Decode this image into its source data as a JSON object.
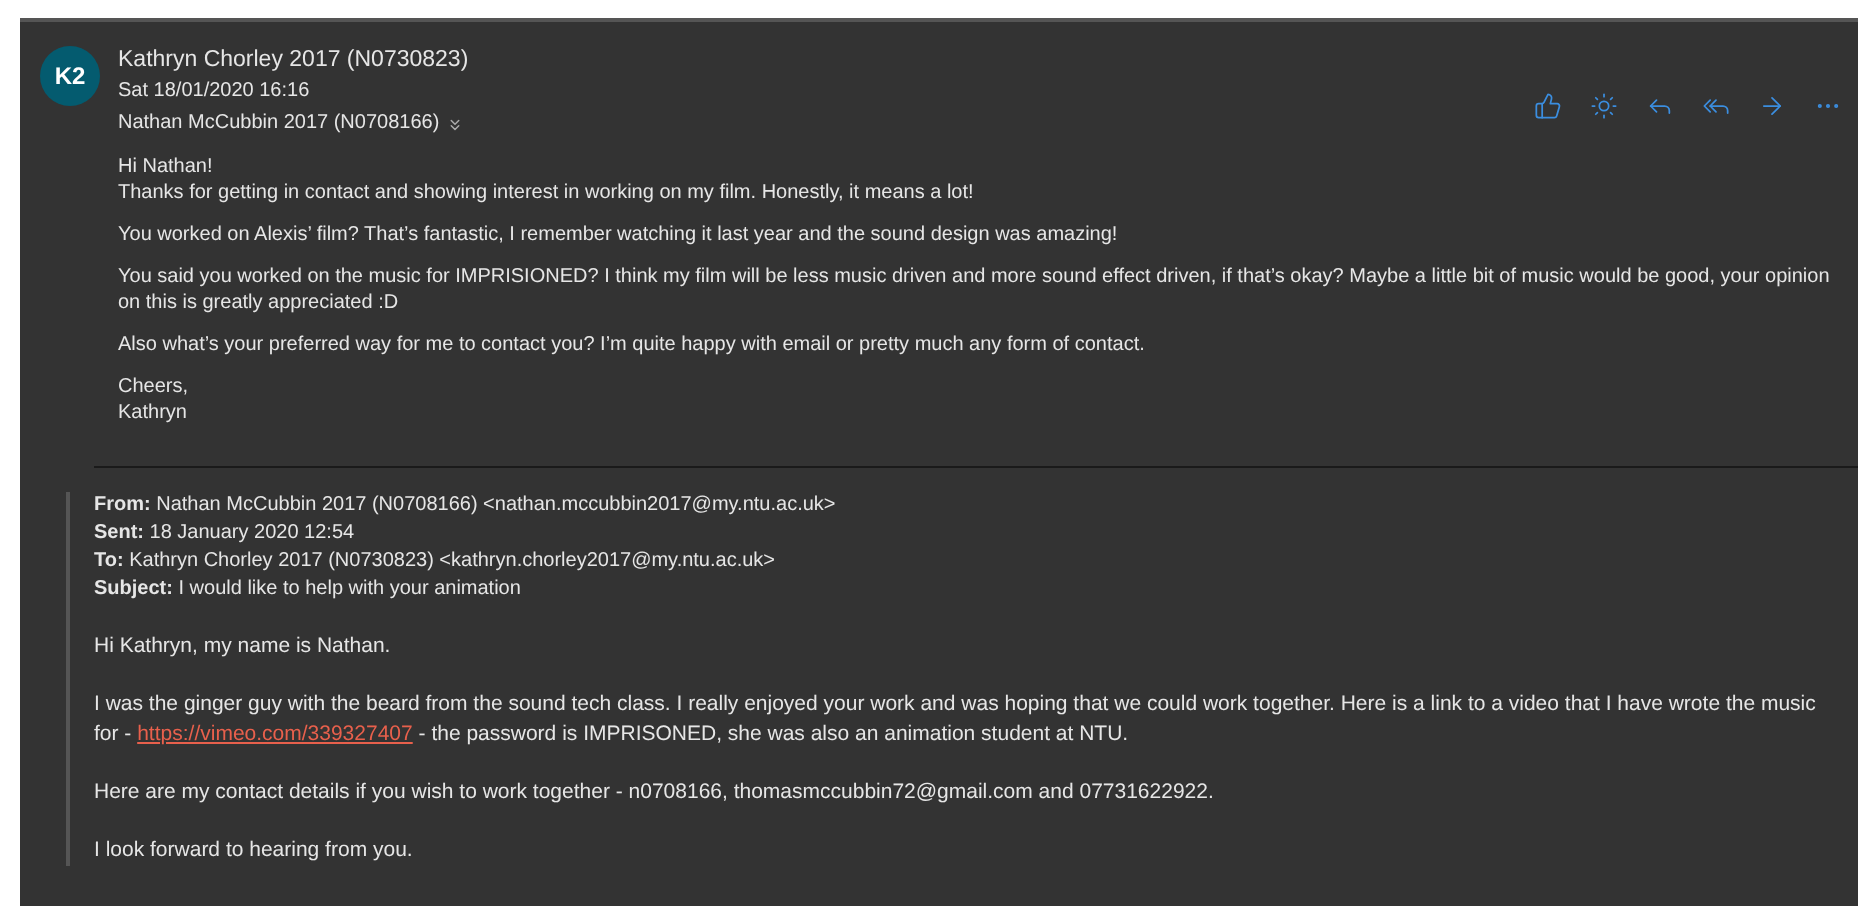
{
  "message": {
    "avatar": "K2",
    "sender": "Kathryn Chorley 2017 (N0730823)",
    "date": "Sat 18/01/2020 16:16",
    "recipient": "Nathan McCubbin 2017 (N0708166)",
    "body": [
      [
        "Hi Nathan!",
        "Thanks for getting in contact and showing interest in working on my film. Honestly, it means a lot!"
      ],
      [
        "You worked on Alexis’ film? That’s fantastic, I remember watching it last year and the sound design was amazing!"
      ],
      [
        "You said you worked on the music for IMPRISIONED? I think my film will be less music driven and more sound effect driven, if that’s okay? Maybe a little bit of music would be good, your opinion on this is greatly appreciated :D"
      ],
      [
        "Also what’s your preferred way for me to contact you? I’m quite happy with email or pretty much any form of contact."
      ],
      [
        "Cheers,",
        "Kathryn"
      ]
    ]
  },
  "quoted": {
    "headers": [
      "**From:** Nathan McCubbin 2017 (N0708166) <nathan.mccubbin2017@my.ntu.ac.uk>",
      "**Sent:** 18 January 2020 12:54",
      "**To:** Kathryn Chorley 2017 (N0730823) <kathryn.chorley2017@my.ntu.ac.uk>",
      "**Subject:** I would like to help with your animation"
    ],
    "paragraphs": [
      {
        "text": "Hi Kathryn, my name is Nathan."
      },
      {
        "text": "I was the ginger guy with the beard from the sound tech class. I really enjoyed your work and was hoping that we could work together. Here is a link to a video that I have wrote the music for -",
        "link": "https://vimeo.com/339327407",
        "after": "- the password is IMPRISONED, she was also an animation student at NTU."
      },
      {
        "text": "Here are my contact details if you wish to work together - n0708166, thomasmccubbin72@gmail.com and 07731622922."
      },
      {
        "text": "I look forward to hearing from you."
      }
    ]
  }
}
